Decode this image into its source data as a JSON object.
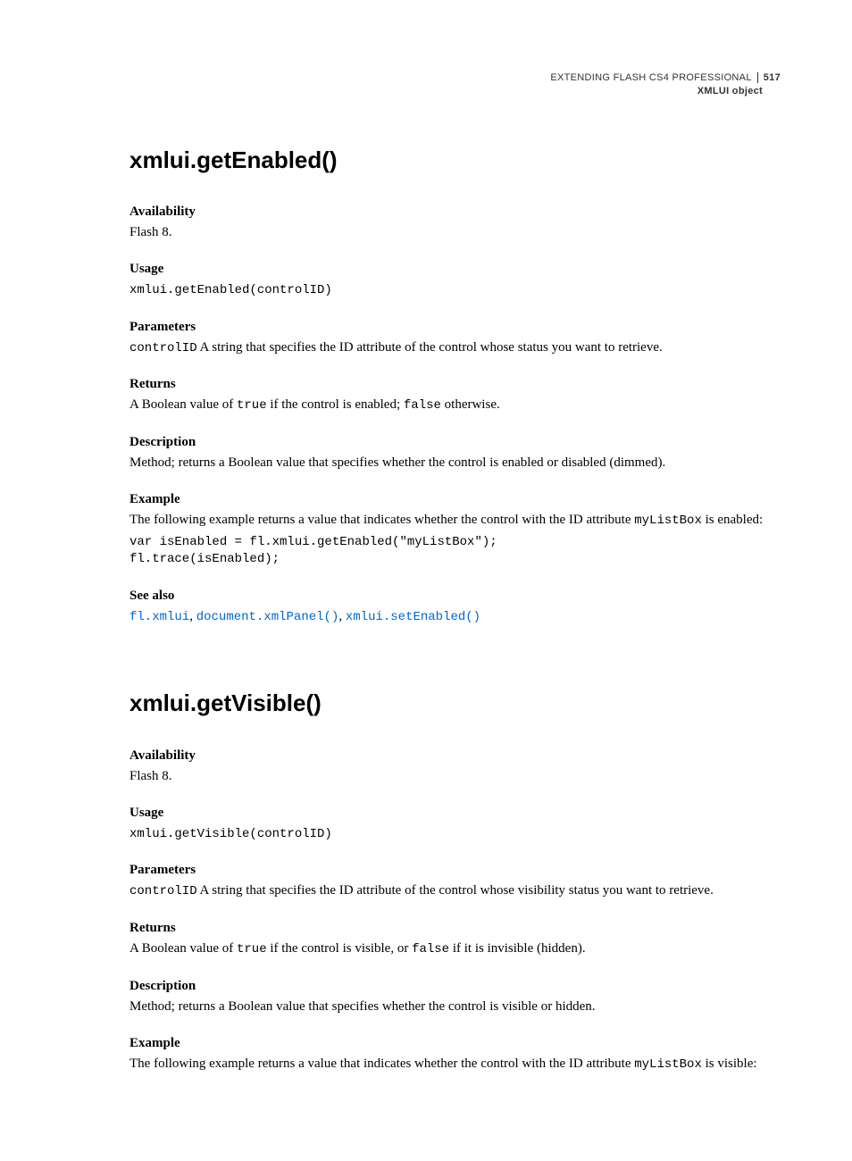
{
  "header": {
    "book_title": "EXTENDING FLASH CS4 PROFESSIONAL",
    "page_num": "517",
    "section": "XMLUI object"
  },
  "s1": {
    "title": "xmlui.getEnabled()",
    "avail_h": "Availability",
    "avail_b": "Flash 8.",
    "usage_h": "Usage",
    "usage_code": "xmlui.getEnabled(controlID)",
    "params_h": "Parameters",
    "param_name": "controlID",
    "param_desc": "  A string that specifies the ID attribute of the control whose status you want to retrieve.",
    "returns_h": "Returns",
    "returns_pre": "A Boolean value of ",
    "returns_true": "true",
    "returns_mid": " if the control is enabled; ",
    "returns_false": "false",
    "returns_post": " otherwise.",
    "desc_h": "Description",
    "desc_b": "Method; returns a Boolean value that specifies whether the control is enabled or disabled (dimmed).",
    "ex_h": "Example",
    "ex_pre": "The following example returns a value that indicates whether the control with the ID attribute ",
    "ex_code_inline": "myListBox",
    "ex_post": " is enabled:",
    "ex_code": "var isEnabled = fl.xmlui.getEnabled(\"myListBox\");\nfl.trace(isEnabled);",
    "see_h": "See also",
    "see1": "fl.xmlui",
    "see2": "document.xmlPanel()",
    "see3": "xmlui.setEnabled()"
  },
  "s2": {
    "title": "xmlui.getVisible()",
    "avail_h": "Availability",
    "avail_b": "Flash 8.",
    "usage_h": "Usage",
    "usage_code": "xmlui.getVisible(controlID)",
    "params_h": "Parameters",
    "param_name": "controlID",
    "param_desc": "  A string that specifies the ID attribute of the control whose visibility status you want to retrieve.",
    "returns_h": "Returns",
    "returns_pre": "A Boolean value of ",
    "returns_true": "true",
    "returns_mid": " if the control is visible, or ",
    "returns_false": "false",
    "returns_post": " if it is invisible (hidden).",
    "desc_h": "Description",
    "desc_b": "Method; returns a Boolean value that specifies whether the control is visible or hidden.",
    "ex_h": "Example",
    "ex_pre": "The following example returns a value that indicates whether the control with the ID attribute ",
    "ex_code_inline": "myListBox",
    "ex_post": " is visible:"
  }
}
